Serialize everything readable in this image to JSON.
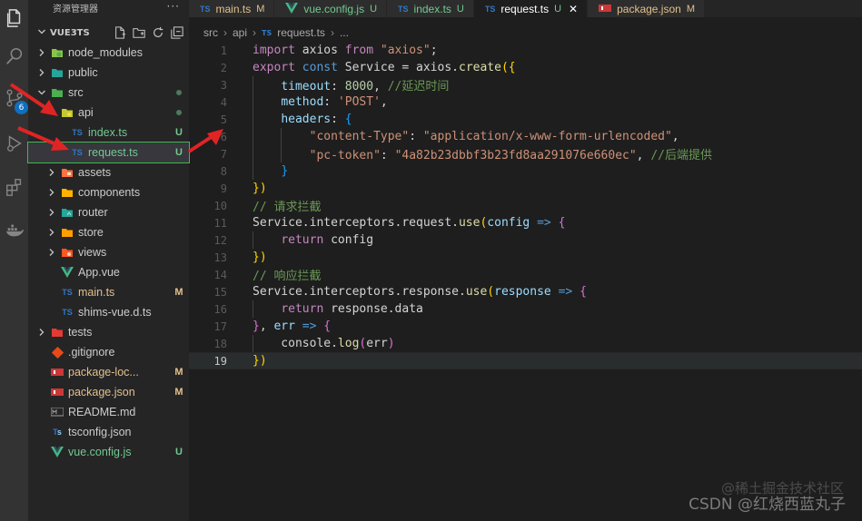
{
  "activity_bar": {
    "items": [
      {
        "icon": "files-icon"
      },
      {
        "icon": "search-icon"
      },
      {
        "icon": "source-control-icon",
        "badge": "6"
      },
      {
        "icon": "run-debug-icon"
      },
      {
        "icon": "extensions-icon"
      },
      {
        "icon": "docker-icon"
      }
    ]
  },
  "sidebar": {
    "title": "资源管理器",
    "more": "···",
    "project": "VUE3TS",
    "tree": [
      {
        "name": "node_modules",
        "depth": 1,
        "chevron": "right",
        "icon": "node",
        "status": "",
        "dot": false
      },
      {
        "name": "public",
        "depth": 1,
        "chevron": "right",
        "icon": "folder-public",
        "status": "",
        "dot": false
      },
      {
        "name": "src",
        "depth": 1,
        "chevron": "down",
        "icon": "folder-src",
        "status": "",
        "dot": true
      },
      {
        "name": "api",
        "depth": 2,
        "chevron": "down",
        "icon": "folder-api",
        "status": "",
        "dot": true
      },
      {
        "name": "index.ts",
        "depth": 3,
        "chevron": "",
        "icon": "ts",
        "status": "U",
        "dot": false
      },
      {
        "name": "request.ts",
        "depth": 3,
        "chevron": "",
        "icon": "ts",
        "status": "U",
        "dot": false,
        "selected": true
      },
      {
        "name": "assets",
        "depth": 2,
        "chevron": "right",
        "icon": "folder-assets",
        "status": "",
        "dot": false
      },
      {
        "name": "components",
        "depth": 2,
        "chevron": "right",
        "icon": "folder-components",
        "status": "",
        "dot": false
      },
      {
        "name": "router",
        "depth": 2,
        "chevron": "right",
        "icon": "folder-router",
        "status": "",
        "dot": false
      },
      {
        "name": "store",
        "depth": 2,
        "chevron": "right",
        "icon": "folder-store",
        "status": "",
        "dot": false
      },
      {
        "name": "views",
        "depth": 2,
        "chevron": "right",
        "icon": "folder-views",
        "status": "",
        "dot": false
      },
      {
        "name": "App.vue",
        "depth": 2,
        "chevron": "",
        "icon": "vue",
        "status": "",
        "dot": false
      },
      {
        "name": "main.ts",
        "depth": 2,
        "chevron": "",
        "icon": "ts",
        "status": "M",
        "dot": false
      },
      {
        "name": "shims-vue.d.ts",
        "depth": 2,
        "chevron": "",
        "icon": "ts",
        "status": "",
        "dot": false
      },
      {
        "name": "tests",
        "depth": 1,
        "chevron": "right",
        "icon": "folder-tests",
        "status": "",
        "dot": false
      },
      {
        "name": ".gitignore",
        "depth": 1,
        "chevron": "",
        "icon": "git",
        "status": "",
        "dot": false
      },
      {
        "name": "package-loc...",
        "depth": 1,
        "chevron": "",
        "icon": "npm",
        "status": "M",
        "dot": false
      },
      {
        "name": "package.json",
        "depth": 1,
        "chevron": "",
        "icon": "npm",
        "status": "M",
        "dot": false
      },
      {
        "name": "README.md",
        "depth": 1,
        "chevron": "",
        "icon": "md",
        "status": "",
        "dot": false
      },
      {
        "name": "tsconfig.json",
        "depth": 1,
        "chevron": "",
        "icon": "tsconfig",
        "status": "",
        "dot": false
      },
      {
        "name": "vue.config.js",
        "depth": 1,
        "chevron": "",
        "icon": "vue",
        "status": "U",
        "dot": false
      }
    ]
  },
  "tabs": [
    {
      "label": "main.ts",
      "icon": "TS",
      "status": "M",
      "active": false
    },
    {
      "label": "vue.config.js",
      "icon": "vue",
      "status": "U",
      "active": false
    },
    {
      "label": "index.ts",
      "icon": "TS",
      "status": "U",
      "active": false
    },
    {
      "label": "request.ts",
      "icon": "TS",
      "status": "U",
      "active": true
    },
    {
      "label": "package.json",
      "icon": "npm",
      "status": "M",
      "active": false
    }
  ],
  "breadcrumb": {
    "parts": [
      "src",
      "api",
      "request.ts",
      "..."
    ],
    "file_icon": "TS"
  },
  "editor": {
    "current_line": 19,
    "lines": [
      [
        [
          "kw2",
          "import"
        ],
        [
          "plain",
          " axios "
        ],
        [
          "kw2",
          "from"
        ],
        [
          "plain",
          " "
        ],
        [
          "str",
          "\"axios\""
        ],
        [
          "plain",
          ";"
        ]
      ],
      [
        [
          "kw2",
          "export"
        ],
        [
          "plain",
          " "
        ],
        [
          "kw",
          "const"
        ],
        [
          "plain",
          " Service = axios."
        ],
        [
          "fn",
          "create"
        ],
        [
          "br1",
          "({"
        ]
      ],
      [
        [
          "plain",
          "    "
        ],
        [
          "prop",
          "timeout"
        ],
        [
          "plain",
          ": "
        ],
        [
          "num",
          "8000"
        ],
        [
          "plain",
          ", "
        ],
        [
          "cmt",
          "//延迟时间"
        ]
      ],
      [
        [
          "plain",
          "    "
        ],
        [
          "prop",
          "method"
        ],
        [
          "plain",
          ": "
        ],
        [
          "str",
          "'POST'"
        ],
        [
          "plain",
          ","
        ]
      ],
      [
        [
          "plain",
          "    "
        ],
        [
          "prop",
          "headers"
        ],
        [
          "plain",
          ": "
        ],
        [
          "br3",
          "{"
        ]
      ],
      [
        [
          "plain",
          "        "
        ],
        [
          "str",
          "\"content-Type\""
        ],
        [
          "plain",
          ": "
        ],
        [
          "str",
          "\"application/x-www-form-urlencoded\""
        ],
        [
          "plain",
          ","
        ]
      ],
      [
        [
          "plain",
          "        "
        ],
        [
          "str",
          "\"pc-token\""
        ],
        [
          "plain",
          ": "
        ],
        [
          "str",
          "\"4a82b23dbbf3b23fd8aa291076e660ec\""
        ],
        [
          "plain",
          ", "
        ],
        [
          "cmt",
          "//后端提供"
        ]
      ],
      [
        [
          "plain",
          "    "
        ],
        [
          "br3",
          "}"
        ]
      ],
      [
        [
          "br1",
          "})"
        ]
      ],
      [
        [
          "cmt",
          "// 请求拦截"
        ]
      ],
      [
        [
          "plain",
          "Service.interceptors.request."
        ],
        [
          "fn",
          "use"
        ],
        [
          "br1",
          "("
        ],
        [
          "param",
          "config"
        ],
        [
          "plain",
          " "
        ],
        [
          "kw",
          "=>"
        ],
        [
          "plain",
          " "
        ],
        [
          "br2",
          "{"
        ]
      ],
      [
        [
          "plain",
          "    "
        ],
        [
          "kw2",
          "return"
        ],
        [
          "plain",
          " config"
        ]
      ],
      [
        [
          "br1",
          "})"
        ]
      ],
      [
        [
          "cmt",
          "// 响应拦截"
        ]
      ],
      [
        [
          "plain",
          "Service.interceptors.response."
        ],
        [
          "fn",
          "use"
        ],
        [
          "br1",
          "("
        ],
        [
          "param",
          "response"
        ],
        [
          "plain",
          " "
        ],
        [
          "kw",
          "=>"
        ],
        [
          "plain",
          " "
        ],
        [
          "br2",
          "{"
        ]
      ],
      [
        [
          "plain",
          "    "
        ],
        [
          "kw2",
          "return"
        ],
        [
          "plain",
          " response.data"
        ]
      ],
      [
        [
          "br2",
          "}"
        ],
        [
          "plain",
          ", "
        ],
        [
          "param",
          "err"
        ],
        [
          "plain",
          " "
        ],
        [
          "kw",
          "=>"
        ],
        [
          "plain",
          " "
        ],
        [
          "br2",
          "{"
        ]
      ],
      [
        [
          "plain",
          "    console."
        ],
        [
          "fn",
          "log"
        ],
        [
          "br2",
          "("
        ],
        [
          "plain",
          "err"
        ],
        [
          "br2",
          ")"
        ]
      ],
      [
        [
          "br1",
          "})"
        ]
      ]
    ]
  },
  "watermark": {
    "line1": "@稀土掘金技术社区",
    "line2": "CSDN @红烧西蓝丸子"
  },
  "colors": {
    "accent": "#0e70c0",
    "modified": "#e2c08d",
    "untracked": "#73c991",
    "arrow": "#e02424"
  }
}
